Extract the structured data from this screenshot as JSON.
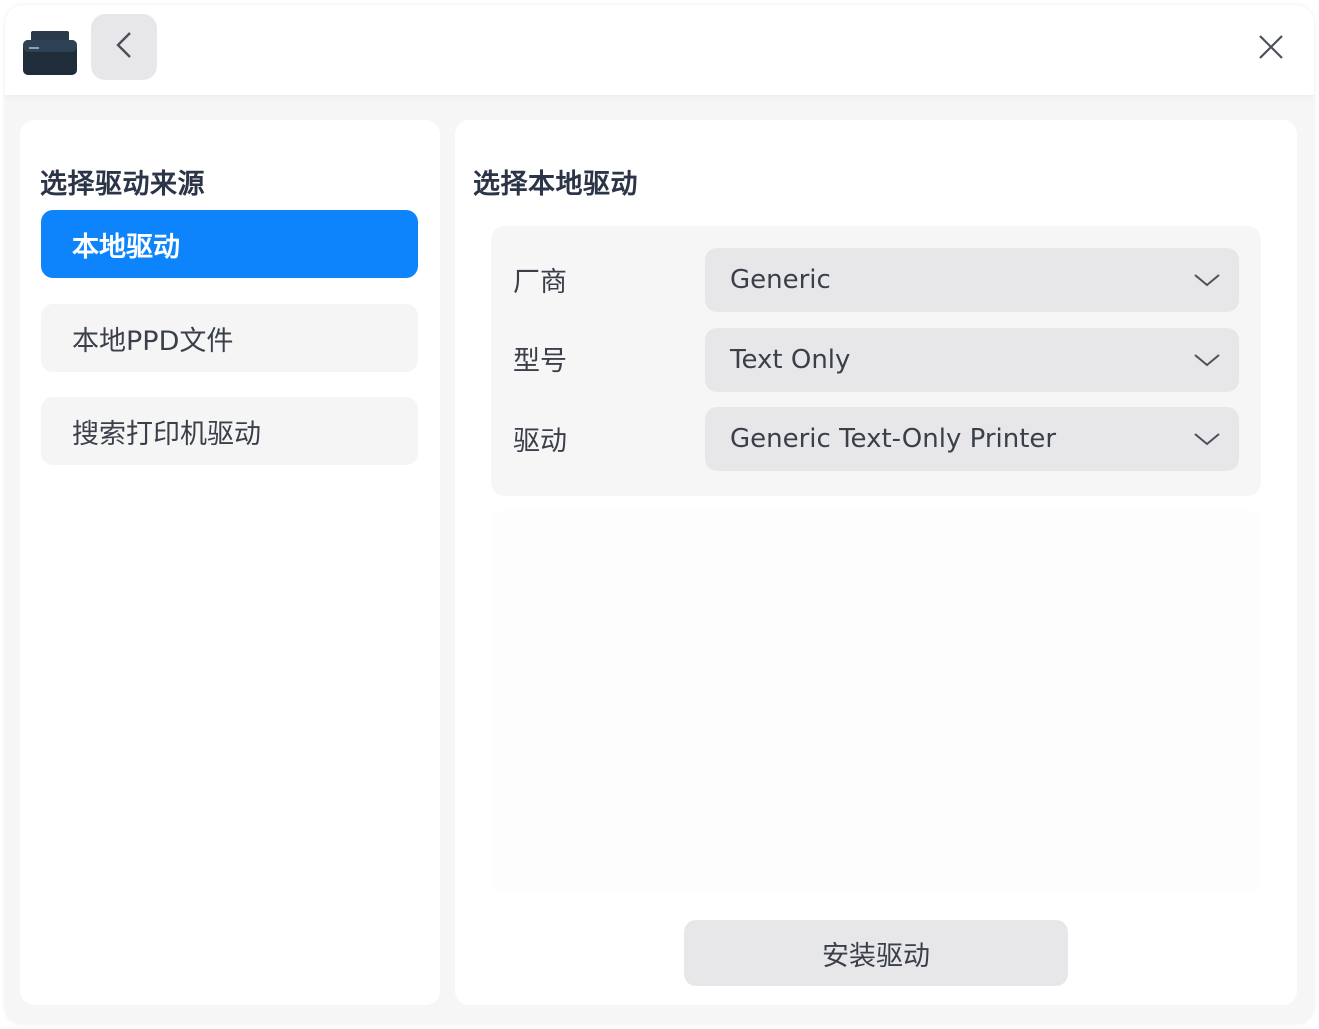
{
  "titlebar": {
    "app_icon": "printer-icon",
    "back_icon": "chevron-left-icon",
    "close_icon": "close-icon"
  },
  "left_panel": {
    "title": "选择驱动来源",
    "items": [
      {
        "label": "本地驱动",
        "active": true
      },
      {
        "label": "本地PPD文件",
        "active": false
      },
      {
        "label": "搜索打印机驱动",
        "active": false
      }
    ]
  },
  "right_panel": {
    "title": "选择本地驱动",
    "fields": [
      {
        "label": "厂商",
        "value": "Generic"
      },
      {
        "label": "型号",
        "value": "Text Only"
      },
      {
        "label": "驱动",
        "value": "Generic Text-Only Printer"
      }
    ],
    "install_label": "安装驱动"
  },
  "colors": {
    "accent": "#0d84fb",
    "window_bg": "#f6f6f7",
    "control_bg": "#e7e7e9",
    "text": "#3a3f4a"
  }
}
